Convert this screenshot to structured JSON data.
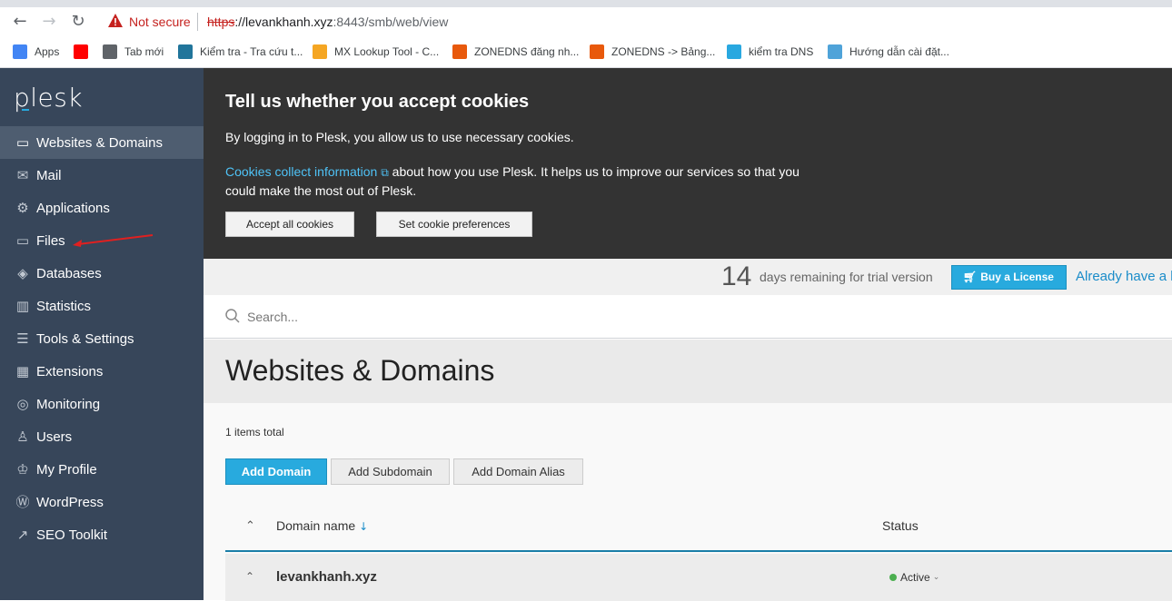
{
  "browser": {
    "security_label": "Not secure",
    "url_scheme": "https",
    "url_host": "://levankhanh.xyz",
    "url_rest": ":8443/smb/web/view",
    "bookmarks": [
      {
        "label": "Apps",
        "icon": "apps-grid-icon",
        "color": "#4285f4"
      },
      {
        "label": "",
        "icon": "youtube-icon",
        "color": "#ff0000"
      },
      {
        "label": "Tab mới",
        "icon": "globe-icon",
        "color": "#5f6368"
      },
      {
        "label": "Kiểm tra - Tra cứu t...",
        "icon": "wordpress-icon",
        "color": "#21759b"
      },
      {
        "label": "MX Lookup Tool - C...",
        "icon": "mxtoolbox-icon",
        "color": "#f5a623"
      },
      {
        "label": "ZONEDNS đăng nh...",
        "icon": "dns-icon",
        "color": "#e8590c"
      },
      {
        "label": "ZONEDNS -> Bảng...",
        "icon": "dns-icon",
        "color": "#e8590c"
      },
      {
        "label": "kiểm tra DNS",
        "icon": "dns-check-icon",
        "color": "#29a8e0"
      },
      {
        "label": "Hướng dẫn cài đặt...",
        "icon": "stack-icon",
        "color": "#4fa3d9"
      }
    ]
  },
  "sidebar": {
    "logo": "plesk",
    "items": [
      {
        "label": "Websites & Domains",
        "icon": "monitor-icon",
        "glyph": "▭",
        "active": true
      },
      {
        "label": "Mail",
        "icon": "mail-icon",
        "glyph": "✉"
      },
      {
        "label": "Applications",
        "icon": "gear-icon",
        "glyph": "⚙"
      },
      {
        "label": "Files",
        "icon": "folder-icon",
        "glyph": "▭"
      },
      {
        "label": "Databases",
        "icon": "database-icon",
        "glyph": "◈"
      },
      {
        "label": "Statistics",
        "icon": "bar-chart-icon",
        "glyph": "▥"
      },
      {
        "label": "Tools & Settings",
        "icon": "sliders-icon",
        "glyph": "☰"
      },
      {
        "label": "Extensions",
        "icon": "extensions-icon",
        "glyph": "▦"
      },
      {
        "label": "Monitoring",
        "icon": "monitoring-icon",
        "glyph": "◎"
      },
      {
        "label": "Users",
        "icon": "user-icon",
        "glyph": "♙"
      },
      {
        "label": "My Profile",
        "icon": "profile-icon",
        "glyph": "♔"
      },
      {
        "label": "WordPress",
        "icon": "wordpress-icon",
        "glyph": "Ⓦ"
      },
      {
        "label": "SEO Toolkit",
        "icon": "seo-icon",
        "glyph": "↗"
      }
    ]
  },
  "cookie": {
    "title": "Tell us whether you accept cookies",
    "p1": "By logging in to Plesk, you allow us to use necessary cookies.",
    "link": "Cookies collect information",
    "p2_rest": " about how you use Plesk. It helps us to improve our services so that you could make the most out of Plesk.",
    "accept_label": "Accept all cookies",
    "prefs_label": "Set cookie preferences"
  },
  "trial": {
    "days": "14",
    "text": "days remaining for trial version",
    "buy_label": "Buy a License",
    "already_label": "Already have a li"
  },
  "search": {
    "placeholder": "Search..."
  },
  "page": {
    "title": "Websites & Domains",
    "total": "1 items total",
    "add_domain": "Add Domain",
    "add_subdomain": "Add Subdomain",
    "add_alias": "Add Domain Alias"
  },
  "table": {
    "col_name": "Domain name",
    "col_status": "Status",
    "rows": [
      {
        "name": "levankhanh.xyz",
        "status": "Active"
      }
    ]
  },
  "colors": {
    "accent": "#28aade",
    "sidebar_bg": "#37465a",
    "status_active": "#4caf50",
    "annotation": "#e02020"
  }
}
